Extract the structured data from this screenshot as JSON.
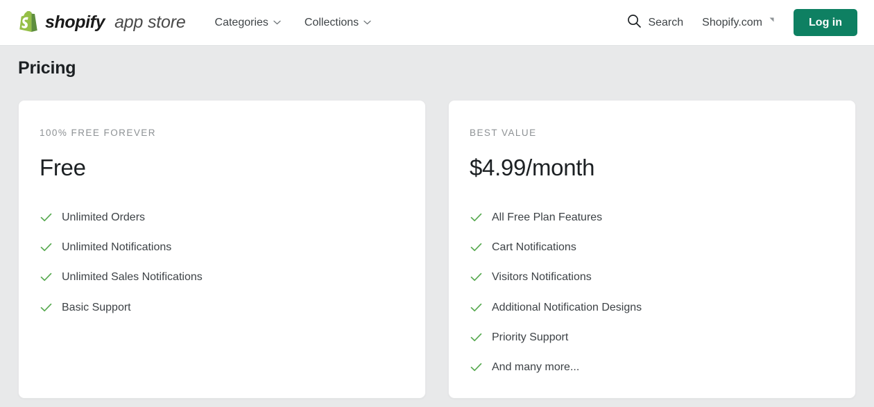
{
  "header": {
    "brand": {
      "name": "shopify",
      "suffix": "app store",
      "logo_color": "#95bf47"
    },
    "nav": [
      {
        "label": "Categories",
        "icon": "chevron-down-icon"
      },
      {
        "label": "Collections",
        "icon": "chevron-down-icon"
      }
    ],
    "search_label": "Search",
    "search_icon": "search-icon",
    "shopify_com_label": "Shopify.com",
    "external_link_icon": "external-link-icon",
    "login_label": "Log in",
    "login_button_color": "#0e8062"
  },
  "main": {
    "page_title": "Pricing",
    "check_icon": "check-icon",
    "check_color": "#5aab53",
    "plans": [
      {
        "eyebrow": "100% FREE FOREVER",
        "price": "Free",
        "features": [
          "Unlimited Orders",
          "Unlimited Notifications",
          "Unlimited Sales Notifications",
          "Basic Support"
        ]
      },
      {
        "eyebrow": "BEST VALUE",
        "price": "$4.99/month",
        "features": [
          "All Free Plan Features",
          "Cart Notifications",
          "Visitors Notifications",
          "Additional Notification Designs",
          "Priority Support",
          "And many more..."
        ]
      }
    ]
  }
}
